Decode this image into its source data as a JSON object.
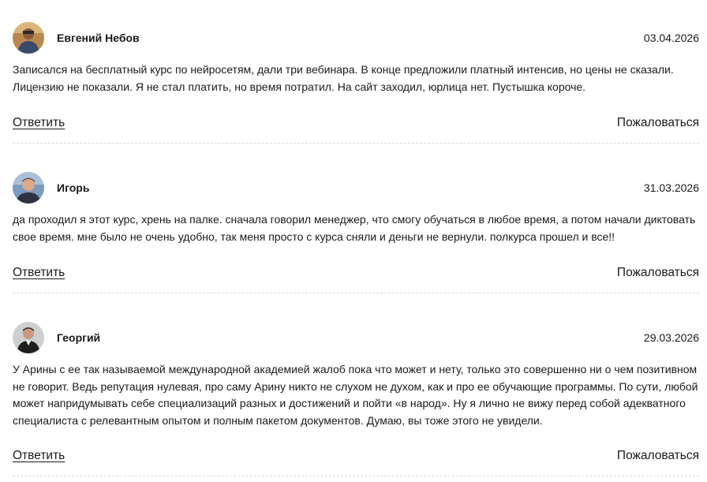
{
  "comments": [
    {
      "author": "Евгений Небов",
      "date": "03.04.2026",
      "text": "Записался на бесплатный курс по нейросетям, дали три вебинара. В конце предложили платный интенсив, но цены не сказали. Лицензию не показали. Я не стал платить, но время потратил. На сайт заходил, юрлица нет. Пустышка короче.",
      "reply_label": "Ответить",
      "report_label": "Пожаловаться"
    },
    {
      "author": "Игорь",
      "date": "31.03.2026",
      "text": "да проходил я этот курс, хрень на палке. сначала говорил менеджер, что смогу обучаться в любое время, а потом начали диктовать свое время. мне было не очень удобно, так меня просто с курса сняли и деньги не вернули. полкурса прошел и все!!",
      "reply_label": "Ответить",
      "report_label": "Пожаловаться"
    },
    {
      "author": "Георгий",
      "date": "29.03.2026",
      "text": "У Арины с ее так называемой международной академией жалоб пока что может и нету, только это совершенно ни о чем позитивном не говорит. Ведь репутация нулевая, про саму Арину никто не слухом не духом, как и про ее обучающие программы. По сути, любой может напридумывать себе специализаций разных и достижений и пойти «в народ». Ну я лично не вижу перед собой адекватного специалиста с релевантным опытом и полным пакетом документов. Думаю, вы тоже этого не увидели.",
      "reply_label": "Ответить",
      "report_label": "Пожаловаться"
    }
  ]
}
